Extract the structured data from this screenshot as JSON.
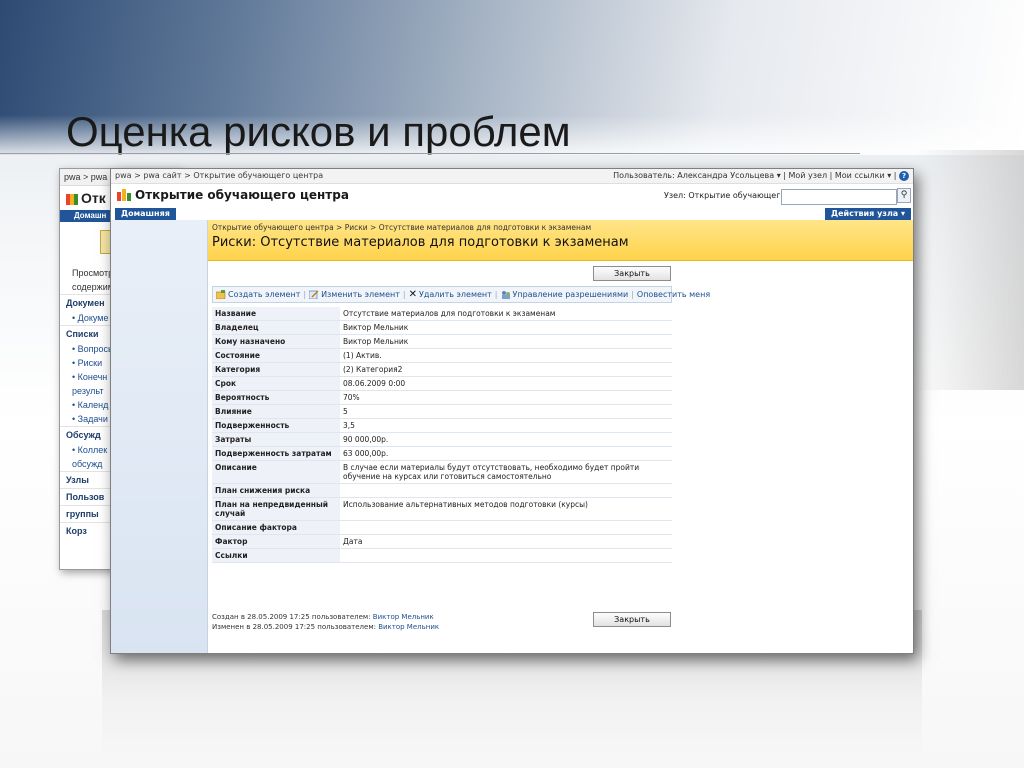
{
  "slide": {
    "title": "Оценка рисков и проблем"
  },
  "back_window": {
    "breadcrumb": "pwa > pwa с",
    "site_title": "Отк",
    "home_tab": "Домашн",
    "items": [
      {
        "kind": "text",
        "label": "Просмотре"
      },
      {
        "kind": "text",
        "label": "содержим"
      },
      {
        "kind": "section",
        "label": "Докумен"
      },
      {
        "kind": "bullet",
        "label": "• Докуме"
      },
      {
        "kind": "section",
        "label": "Списки"
      },
      {
        "kind": "bullet",
        "label": "• Вопросы"
      },
      {
        "kind": "bullet",
        "label": "• Риски"
      },
      {
        "kind": "bullet",
        "label": "• Конечн"
      },
      {
        "kind": "bullet",
        "label": "результ"
      },
      {
        "kind": "bullet",
        "label": "• Календ"
      },
      {
        "kind": "bullet",
        "label": "• Задачи"
      },
      {
        "kind": "section",
        "label": "Обсужд"
      },
      {
        "kind": "bullet",
        "label": "• Коллек"
      },
      {
        "kind": "bullet",
        "label": "обсужд"
      },
      {
        "kind": "section",
        "label": "Узлы"
      },
      {
        "kind": "section",
        "label": "Пользов"
      },
      {
        "kind": "section",
        "label": "группы"
      },
      {
        "kind": "section",
        "label": "Корз"
      }
    ]
  },
  "window": {
    "breadcrumb": "pwa > pwa сайт > Открытие обучающего центра",
    "user_menu": "Пользователь: Александра Усольцева ▾  |  Мой узел  |  Мои ссылки ▾  |",
    "help_icon": "help-icon",
    "site_title": "Открытие обучающего центра",
    "scope_label": "Узел: Открытие обучающег ▾",
    "search_placeholder": "",
    "nav_home": "Домашняя",
    "site_actions": "Действия узла ▾"
  },
  "page": {
    "breadcrumb": "Открытие обучающего центра > Риски > Отсутствие материалов для подготовки к экзаменам",
    "title": "Риски: Отсутствие материалов для подготовки к экзаменам",
    "close_label": "Закрыть",
    "toolbar": {
      "create": "Создать элемент",
      "edit": "Изменить элемент",
      "delete": "Удалить элемент",
      "permissions": "Управление разрешениями",
      "alert": "Оповестить меня"
    },
    "fields": [
      {
        "label": "Название",
        "value": "Отсутствие материалов для подготовки к экзаменам",
        "link": false
      },
      {
        "label": "Владелец",
        "value": "Виктор Мельник",
        "link": true
      },
      {
        "label": "Кому назначено",
        "value": "Виктор Мельник",
        "link": true
      },
      {
        "label": "Состояние",
        "value": "(1) Актив.",
        "link": false
      },
      {
        "label": "Категория",
        "value": "(2) Категория2",
        "link": false
      },
      {
        "label": "Срок",
        "value": "08.06.2009 0:00",
        "link": false
      },
      {
        "label": "Вероятность",
        "value": "70%",
        "link": false
      },
      {
        "label": "Влияние",
        "value": "5",
        "link": false
      },
      {
        "label": "Подверженность",
        "value": "3,5",
        "link": false
      },
      {
        "label": "Затраты",
        "value": "90 000,00р.",
        "link": false
      },
      {
        "label": "Подверженность затратам",
        "value": "63 000,00р.",
        "link": false
      },
      {
        "label": "Описание",
        "value": "В случае если материалы будут отсутствовать, необходимо будет пройти обучение на курсах или готовиться самостоятельно",
        "link": false
      },
      {
        "label": "План снижения риска",
        "value": "",
        "link": false
      },
      {
        "label": "План на непредвиденный случай",
        "value": "Использование альтернативных методов подготовки (курсы)",
        "link": false
      },
      {
        "label": "Описание фактора",
        "value": "",
        "link": false
      },
      {
        "label": "Фактор",
        "value": "Дата",
        "link": false
      },
      {
        "label": "Ссылки",
        "value": "",
        "link": false
      }
    ],
    "created_prefix": "Создан в 28.05.2009 17:25  пользователем: ",
    "created_by": "Виктор Мельник",
    "modified_prefix": "Изменен в 28.05.2009 17:25  пользователем: ",
    "modified_by": "Виктор Мельник"
  }
}
